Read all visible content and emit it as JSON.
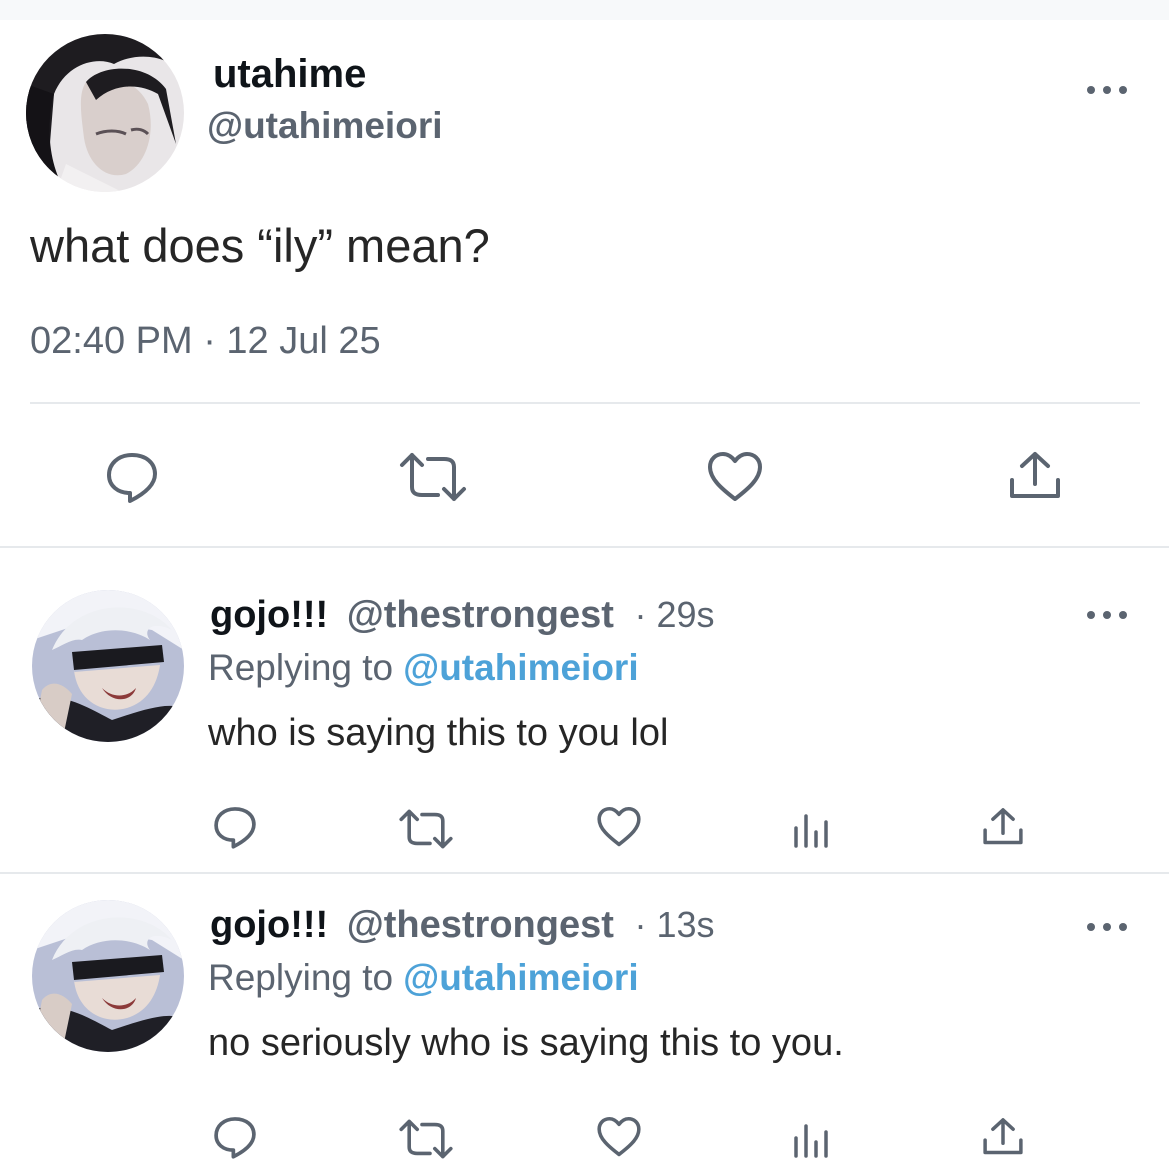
{
  "main_tweet": {
    "display_name": "utahime",
    "handle": "@utahimeiori",
    "text": "what does “ily” mean?",
    "timestamp": "02:40 PM · 12 Jul 25",
    "menu_icon": "more-horizontal-icon",
    "actions": [
      "reply-icon",
      "retweet-icon",
      "like-icon",
      "share-icon"
    ]
  },
  "replies": [
    {
      "display_name": "gojo!!!",
      "handle": "@thestrongest",
      "time": "· 29s",
      "replying_prefix": "Replying to",
      "replying_handle": "@utahimeiori",
      "text": "who is saying this to you lol",
      "actions": [
        "reply-icon",
        "retweet-icon",
        "like-icon",
        "analytics-icon",
        "share-icon"
      ]
    },
    {
      "display_name": "gojo!!!",
      "handle": "@thestrongest",
      "time": "· 13s",
      "replying_prefix": "Replying to",
      "replying_handle": "@utahimeiori",
      "text": "no seriously who is saying this to you.",
      "actions": [
        "reply-icon",
        "retweet-icon",
        "like-icon",
        "analytics-icon",
        "share-icon"
      ]
    }
  ],
  "colors": {
    "text": "#0f1419",
    "secondary": "#5b6470",
    "mention": "#4da2d8",
    "divider": "#e6e9ec"
  }
}
